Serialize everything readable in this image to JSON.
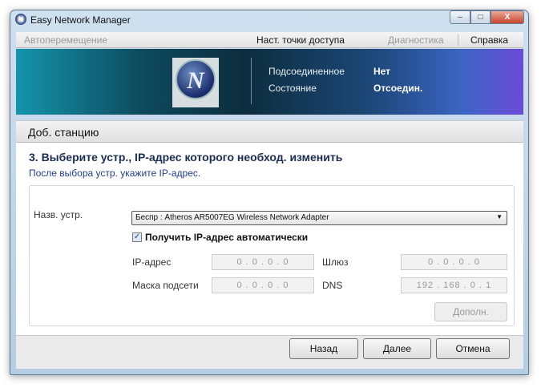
{
  "window": {
    "title": "Easy Network Manager",
    "minimize": "–",
    "maximize": "□",
    "close": "X",
    "app_icon": "N"
  },
  "menu": {
    "auto_move": "Автоперемещение",
    "ap_settings": "Наст. точки доступа",
    "diagnostics": "Диагностика",
    "help": "Справка"
  },
  "banner": {
    "logo": "N",
    "connected_label": "Подсоединенное",
    "connected_value": "Нет",
    "state_label": "Состояние",
    "state_value": "Отсоедин."
  },
  "section": {
    "title": "Доб. станцию",
    "step": "3. Выберите устр., IP-адрес которого необход. изменить",
    "hint": "После выбора устр. укажите IP-адрес."
  },
  "form": {
    "device_label": "Назв. устр.",
    "device_value": "Беспр : Atheros AR5007EG Wireless Network Adapter",
    "auto_ip_label": "Получить IP-адрес автоматически",
    "auto_ip_checked": true,
    "check_mark": "✓",
    "ip_label": "IP-адрес",
    "ip_value": "0 . 0 . 0 . 0",
    "mask_label": "Маска подсети",
    "mask_value": "0 . 0 . 0 . 0",
    "gateway_label": "Шлюз",
    "gateway_value": "0 . 0 . 0 . 0",
    "dns_label": "DNS",
    "dns_value": "192 . 168 . 0 . 1",
    "advanced": "Дополн.",
    "dropdown_arrow": "▼"
  },
  "buttons": {
    "back": "Назад",
    "next": "Далее",
    "cancel": "Отмена"
  }
}
